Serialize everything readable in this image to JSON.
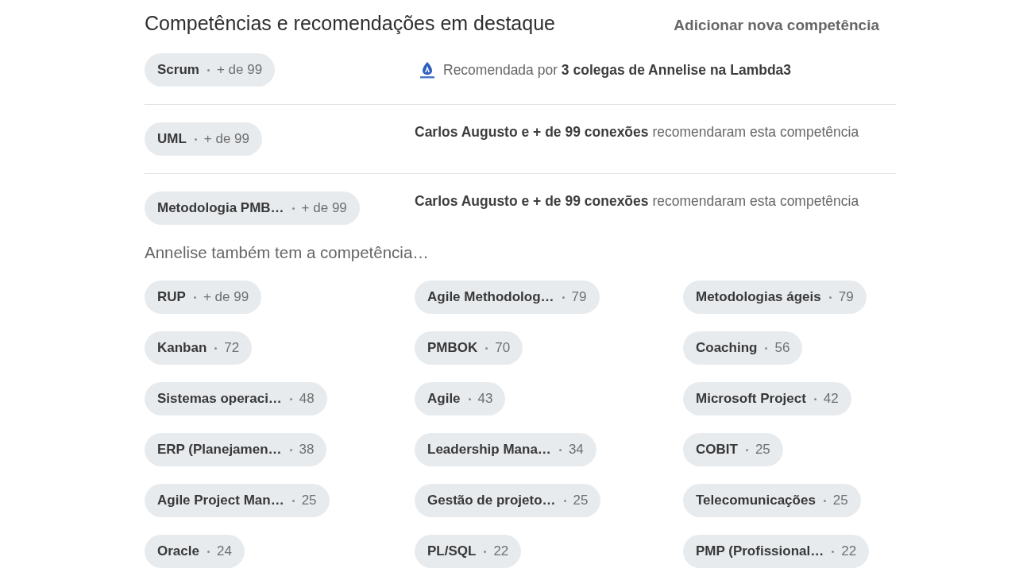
{
  "section": {
    "title": "Competências e recomendações em destaque",
    "add_link": "Adicionar nova competência"
  },
  "featured": [
    {
      "skill": "Scrum",
      "count": "+ de 99",
      "recommendation": {
        "kind": "company",
        "text": "Recomendada por **3 colegas de Annelise na Lambda3**"
      }
    },
    {
      "skill": "UML",
      "count": "+ de 99",
      "recommendation": {
        "kind": "connections",
        "text": "**Carlos Augusto e + de 99 conexões** recomendaram esta competência"
      }
    },
    {
      "skill": "Metodologia PMB…",
      "count": "+ de 99",
      "recommendation": {
        "kind": "connections",
        "text": "**Carlos Augusto e + de 99 conexões** recomendaram esta competência"
      }
    }
  ],
  "other_heading": "Annelise também tem a competência…",
  "other_skills": [
    {
      "skill": "RUP",
      "count": "+ de 99"
    },
    {
      "skill": "Agile Methodolog…",
      "count": "79"
    },
    {
      "skill": "Metodologias ágeis",
      "count": "79"
    },
    {
      "skill": "Kanban",
      "count": "72"
    },
    {
      "skill": "PMBOK",
      "count": "70"
    },
    {
      "skill": "Coaching",
      "count": "56"
    },
    {
      "skill": "Sistemas operaci…",
      "count": "48"
    },
    {
      "skill": "Agile",
      "count": "43"
    },
    {
      "skill": "Microsoft Project",
      "count": "42"
    },
    {
      "skill": "ERP (Planejamen…",
      "count": "38"
    },
    {
      "skill": "Leadership Mana…",
      "count": "34"
    },
    {
      "skill": "COBIT",
      "count": "25"
    },
    {
      "skill": "Agile Project Man…",
      "count": "25"
    },
    {
      "skill": "Gestão de projeto…",
      "count": "25"
    },
    {
      "skill": "Telecomunicações",
      "count": "25"
    },
    {
      "skill": "Oracle",
      "count": "24"
    },
    {
      "skill": "PL/SQL",
      "count": "22"
    },
    {
      "skill": "PMP (Profissional…",
      "count": "22"
    }
  ]
}
